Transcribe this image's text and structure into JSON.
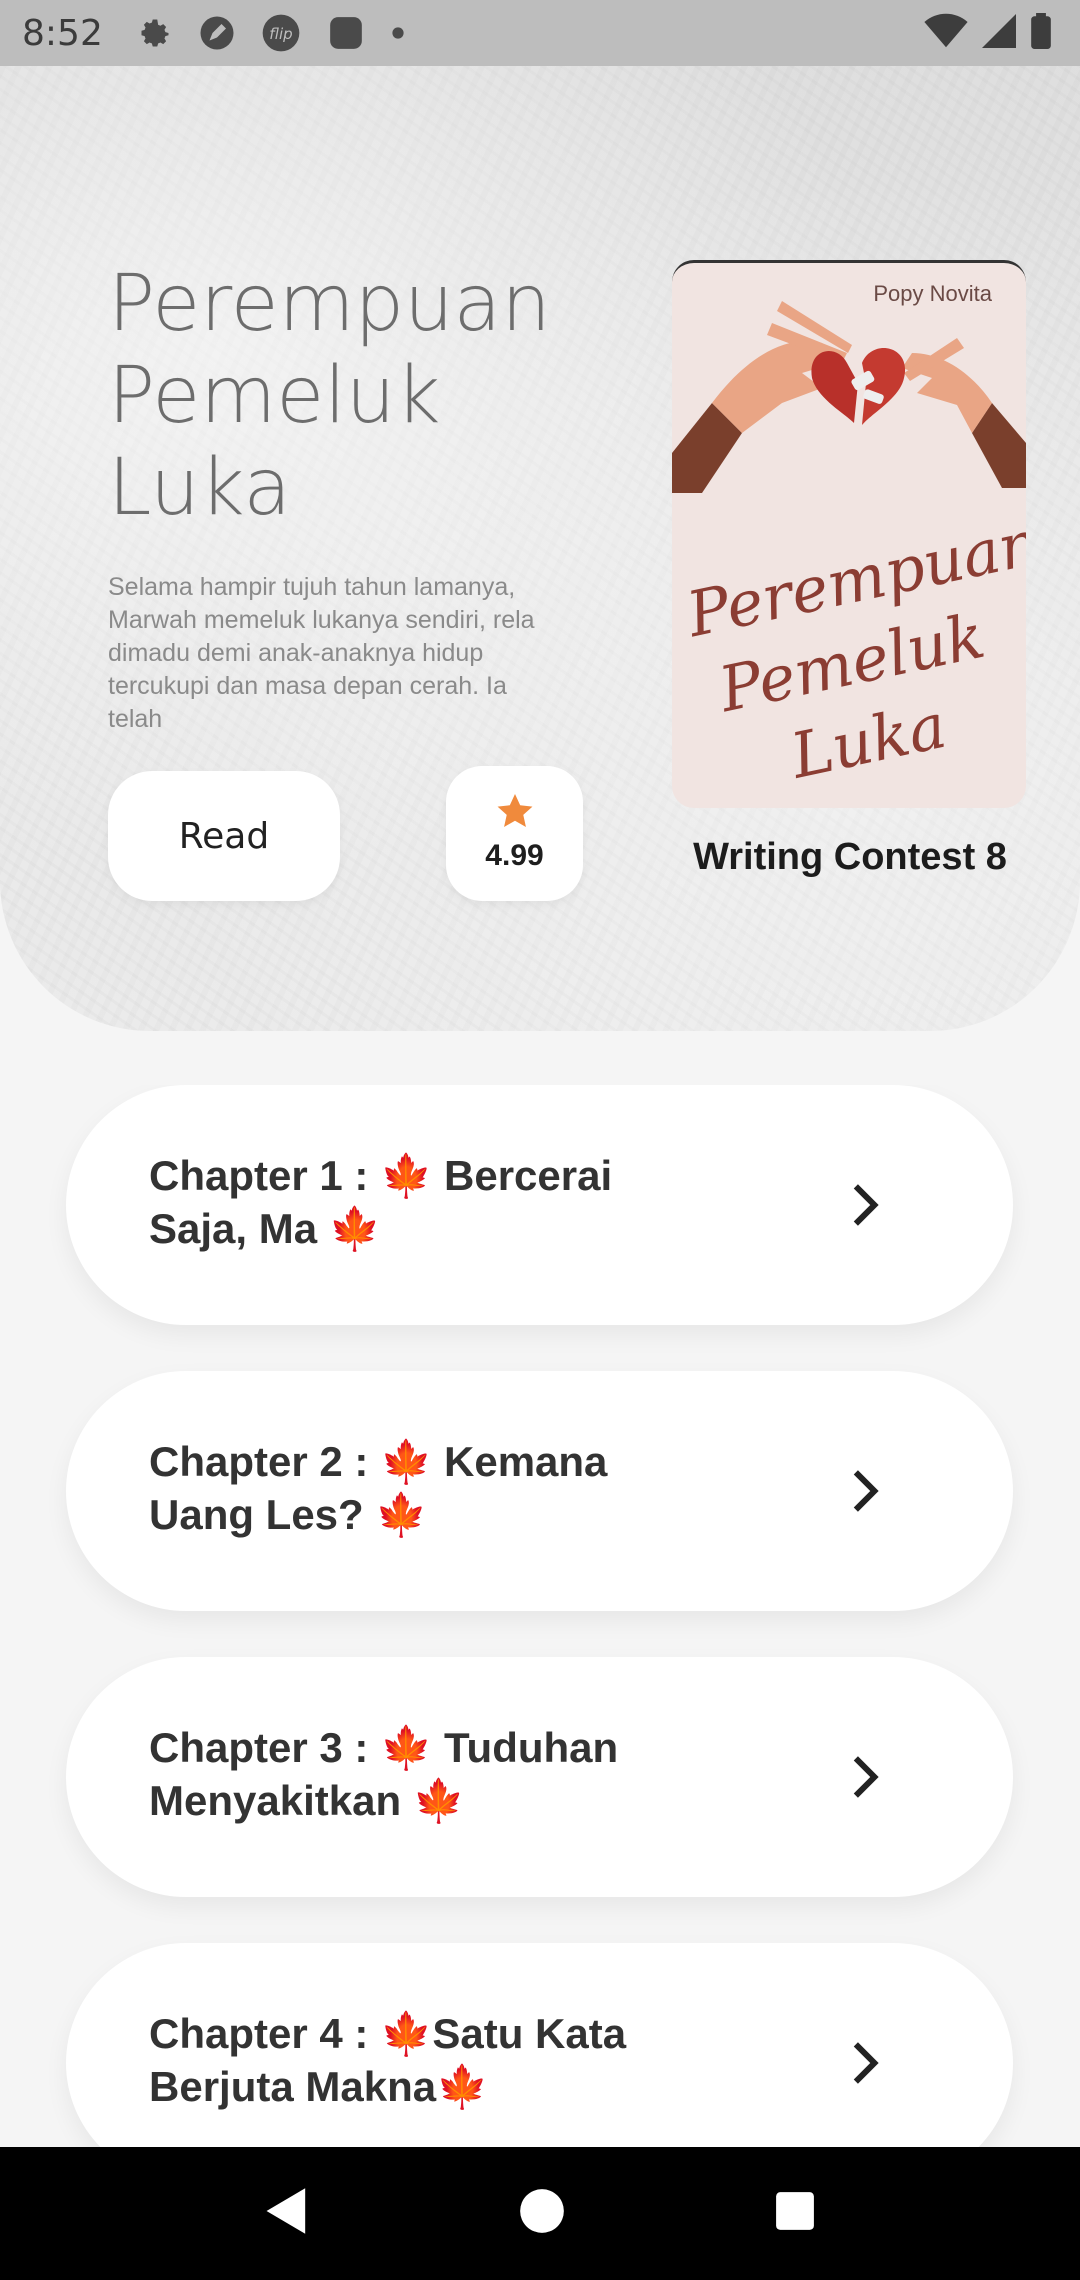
{
  "status_bar": {
    "time": "8:52",
    "left_icons": [
      "gear-icon",
      "pen-icon",
      "flip-icon",
      "square-app-icon",
      "dot-icon"
    ],
    "right_icons": [
      "wifi-icon",
      "signal-icon",
      "battery-icon"
    ]
  },
  "book": {
    "title": "Perempuan\nPemeluk\nLuka",
    "description": "Selama hampir tujuh tahun lamanya, Marwah memeluk lukanya sendiri, rela dimadu demi anak-anaknya hidup tercukupi dan masa depan cerah. Ia telah",
    "read_label": "Read",
    "rating": "4.99",
    "cover_author": "Popy Novita",
    "cover_title": "Perempuan\nPemeluk\nLuka",
    "contest": "Writing Contest 8"
  },
  "chapters": [
    {
      "title": "Chapter 1 : 🍁 Bercerai Saja, Ma 🍁"
    },
    {
      "title": "Chapter 2 : 🍁 Kemana Uang Les? 🍁"
    },
    {
      "title": "Chapter 3 : 🍁 Tuduhan Menyakitkan 🍁"
    },
    {
      "title": "Chapter 4 : 🍁Satu Kata Berjuta Makna🍁"
    }
  ],
  "nav": [
    "back-icon",
    "home-icon",
    "recents-icon"
  ],
  "colors": {
    "accent_star": "#f08a3c",
    "title_gray": "#6d6d6d",
    "cover_bg": "#f1e4e1",
    "cover_text": "#8b3d33"
  }
}
